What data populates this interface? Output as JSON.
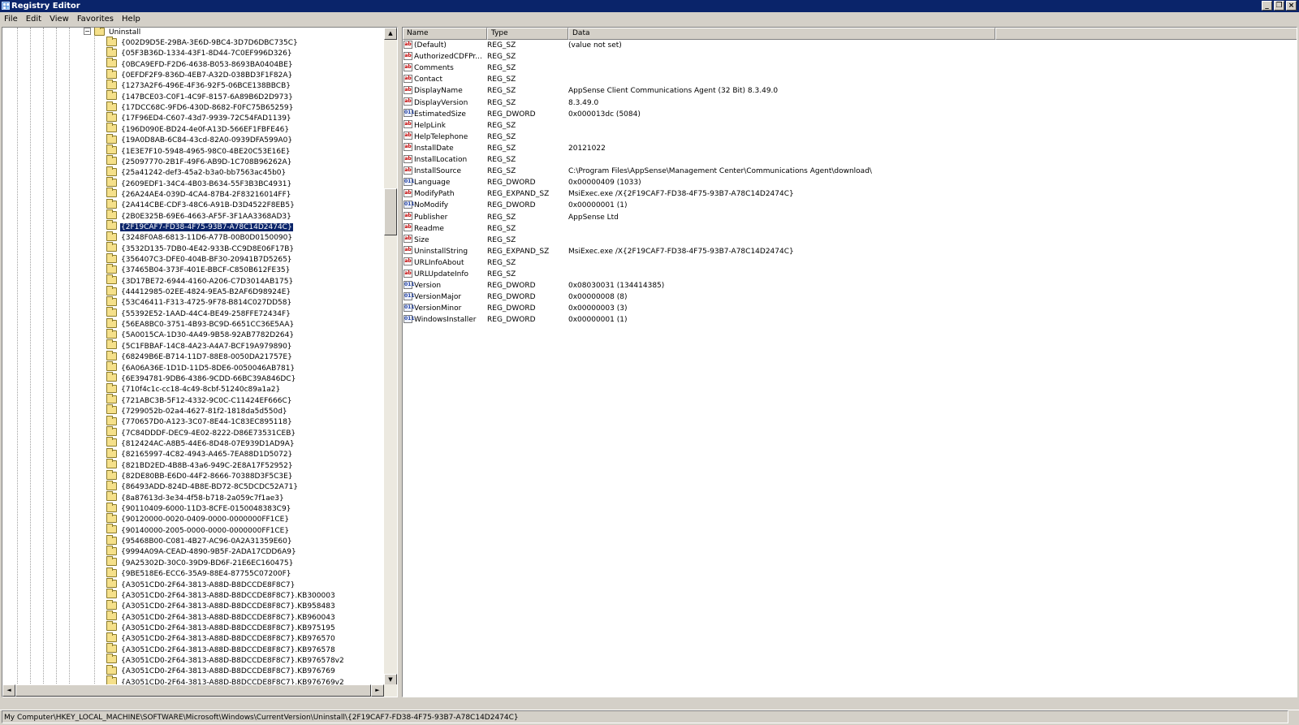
{
  "window": {
    "title": "Registry Editor"
  },
  "menu": [
    "File",
    "Edit",
    "View",
    "Favorites",
    "Help"
  ],
  "tree": {
    "parent_label": "Uninstall",
    "expander": "−",
    "selected_index": 18,
    "items": [
      "{002D9D5E-29BA-3E6D-9BC4-3D7D6DBC735C}",
      "{05F3B36D-1334-43F1-8D44-7C0EF996D326}",
      "{0BCA9EFD-F2D6-4638-B053-8693BA0404BE}",
      "{0EFDF2F9-836D-4EB7-A32D-038BD3F1F82A}",
      "{1273A2F6-496E-4F36-92F5-06BCE138BBCB}",
      "{147BCE03-C0F1-4C9F-8157-6A89B6D2D973}",
      "{17DCC68C-9FD6-430D-8682-F0FC75B65259}",
      "{17F96ED4-C607-43d7-9939-72C54FAD1139}",
      "{196D090E-BD24-4e0f-A13D-566EF1FBFE46}",
      "{19A0D8AB-6C84-43cd-82A0-0939DFA599A0}",
      "{1E3E7F10-5948-4965-98C0-4BE20C53E16E}",
      "{25097770-2B1F-49F6-AB9D-1C708B96262A}",
      "{25a41242-def3-45a2-b3a0-bb7563ac45b0}",
      "{2609EDF1-34C4-4B03-B634-55F3B3BC4931}",
      "{26A24AE4-039D-4CA4-87B4-2F83216014FF}",
      "{2A414CBE-CDF3-48C6-A91B-D3D4522F8EB5}",
      "{2B0E325B-69E6-4663-AF5F-3F1AA3368AD3}",
      "{2F19CAF7-FD38-4F75-93B7-A78C14D2474C}",
      "{3248F0A8-6813-11D6-A77B-00B0D0150090}",
      "{3532D135-7DB0-4E42-933B-CC9D8E06F17B}",
      "{356407C3-DFE0-404B-BF30-20941B7D5265}",
      "{37465B04-373F-401E-BBCF-C850B612FE35}",
      "{3D17BE72-6944-4160-A206-C7D3014AB175}",
      "{44412985-02EE-4824-9EA5-B2AF6D98924E}",
      "{53C46411-F313-4725-9F78-B814C027DD58}",
      "{55392E52-1AAD-44C4-BE49-258FFE72434F}",
      "{56EA8BC0-3751-4B93-BC9D-6651CC36E5AA}",
      "{5A0015CA-1D30-4A49-9B58-92AB7782D264}",
      "{5C1FBBAF-14C8-4A23-A4A7-BCF19A979890}",
      "{68249B6E-B714-11D7-88E8-0050DA21757E}",
      "{6A06A36E-1D1D-11D5-8DE6-0050046AB781}",
      "{6E394781-9DB6-4386-9CDD-66BC39A846DC}",
      "{710f4c1c-cc18-4c49-8cbf-51240c89a1a2}",
      "{721ABC3B-5F12-4332-9C0C-C11424EF666C}",
      "{7299052b-02a4-4627-81f2-1818da5d550d}",
      "{770657D0-A123-3C07-8E44-1C83EC895118}",
      "{7C84DDDF-DEC9-4E02-8222-D86E73531CEB}",
      "{812424AC-A8B5-44E6-8D48-07E939D1AD9A}",
      "{82165997-4C82-4943-A465-7EA88D1D5072}",
      "{821BD2ED-4B8B-43a6-949C-2E8A17F52952}",
      "{82DE80BB-E6D0-44F2-8666-70388D3F5C3E}",
      "{86493ADD-824D-4B8E-BD72-8C5DCDC52A71}",
      "{8a87613d-3e34-4f58-b718-2a059c7f1ae3}",
      "{90110409-6000-11D3-8CFE-0150048383C9}",
      "{90120000-0020-0409-0000-0000000FF1CE}",
      "{90140000-2005-0000-0000-0000000FF1CE}",
      "{95468B00-C081-4B27-AC96-0A2A31359E60}",
      "{9994A09A-CEAD-4890-9B5F-2ADA17CDD6A9}",
      "{9A25302D-30C0-39D9-BD6F-21E6EC160475}",
      "{9BE518E6-ECC6-35A9-88E4-87755C07200F}",
      "{A3051CD0-2F64-3813-A88D-B8DCCDE8F8C7}",
      "{A3051CD0-2F64-3813-A88D-B8DCCDE8F8C7}.KB300003",
      "{A3051CD0-2F64-3813-A88D-B8DCCDE8F8C7}.KB958483",
      "{A3051CD0-2F64-3813-A88D-B8DCCDE8F8C7}.KB960043",
      "{A3051CD0-2F64-3813-A88D-B8DCCDE8F8C7}.KB975195",
      "{A3051CD0-2F64-3813-A88D-B8DCCDE8F8C7}.KB976570",
      "{A3051CD0-2F64-3813-A88D-B8DCCDE8F8C7}.KB976578",
      "{A3051CD0-2F64-3813-A88D-B8DCCDE8F8C7}.KB976578v2",
      "{A3051CD0-2F64-3813-A88D-B8DCCDE8F8C7}.KB976769",
      "{A3051CD0-2F64-3813-A88D-B8DCCDE8F8C7}.KB976769v2"
    ]
  },
  "list": {
    "columns": [
      "Name",
      "Type",
      "Data"
    ],
    "rows": [
      {
        "icon": "string-value-icon",
        "name": "(Default)",
        "type": "REG_SZ",
        "data": "(value not set)"
      },
      {
        "icon": "string-value-icon",
        "name": "AuthorizedCDFPr...",
        "type": "REG_SZ",
        "data": ""
      },
      {
        "icon": "string-value-icon",
        "name": "Comments",
        "type": "REG_SZ",
        "data": ""
      },
      {
        "icon": "string-value-icon",
        "name": "Contact",
        "type": "REG_SZ",
        "data": ""
      },
      {
        "icon": "string-value-icon",
        "name": "DisplayName",
        "type": "REG_SZ",
        "data": "AppSense Client Communications Agent (32 Bit) 8.3.49.0"
      },
      {
        "icon": "string-value-icon",
        "name": "DisplayVersion",
        "type": "REG_SZ",
        "data": "8.3.49.0"
      },
      {
        "icon": "dword-value-icon",
        "name": "EstimatedSize",
        "type": "REG_DWORD",
        "data": "0x000013dc (5084)"
      },
      {
        "icon": "string-value-icon",
        "name": "HelpLink",
        "type": "REG_SZ",
        "data": ""
      },
      {
        "icon": "string-value-icon",
        "name": "HelpTelephone",
        "type": "REG_SZ",
        "data": ""
      },
      {
        "icon": "string-value-icon",
        "name": "InstallDate",
        "type": "REG_SZ",
        "data": "20121022"
      },
      {
        "icon": "string-value-icon",
        "name": "InstallLocation",
        "type": "REG_SZ",
        "data": ""
      },
      {
        "icon": "string-value-icon",
        "name": "InstallSource",
        "type": "REG_SZ",
        "data": "C:\\Program Files\\AppSense\\Management Center\\Communications Agent\\download\\"
      },
      {
        "icon": "dword-value-icon",
        "name": "Language",
        "type": "REG_DWORD",
        "data": "0x00000409 (1033)"
      },
      {
        "icon": "string-value-icon",
        "name": "ModifyPath",
        "type": "REG_EXPAND_SZ",
        "data": "MsiExec.exe /X{2F19CAF7-FD38-4F75-93B7-A78C14D2474C}"
      },
      {
        "icon": "dword-value-icon",
        "name": "NoModify",
        "type": "REG_DWORD",
        "data": "0x00000001 (1)"
      },
      {
        "icon": "string-value-icon",
        "name": "Publisher",
        "type": "REG_SZ",
        "data": "AppSense Ltd"
      },
      {
        "icon": "string-value-icon",
        "name": "Readme",
        "type": "REG_SZ",
        "data": ""
      },
      {
        "icon": "string-value-icon",
        "name": "Size",
        "type": "REG_SZ",
        "data": ""
      },
      {
        "icon": "string-value-icon",
        "name": "UninstallString",
        "type": "REG_EXPAND_SZ",
        "data": "MsiExec.exe /X{2F19CAF7-FD38-4F75-93B7-A78C14D2474C}"
      },
      {
        "icon": "string-value-icon",
        "name": "URLInfoAbout",
        "type": "REG_SZ",
        "data": ""
      },
      {
        "icon": "string-value-icon",
        "name": "URLUpdateInfo",
        "type": "REG_SZ",
        "data": ""
      },
      {
        "icon": "dword-value-icon",
        "name": "Version",
        "type": "REG_DWORD",
        "data": "0x08030031 (134414385)"
      },
      {
        "icon": "dword-value-icon",
        "name": "VersionMajor",
        "type": "REG_DWORD",
        "data": "0x00000008 (8)"
      },
      {
        "icon": "dword-value-icon",
        "name": "VersionMinor",
        "type": "REG_DWORD",
        "data": "0x00000003 (3)"
      },
      {
        "icon": "dword-value-icon",
        "name": "WindowsInstaller",
        "type": "REG_DWORD",
        "data": "0x00000001 (1)"
      }
    ]
  },
  "statusbar": {
    "path": "My Computer\\HKEY_LOCAL_MACHINE\\SOFTWARE\\Microsoft\\Windows\\CurrentVersion\\Uninstall\\{2F19CAF7-FD38-4F75-93B7-A78C14D2474C}"
  },
  "colors": {
    "titlebar": "#0a246a",
    "selection": "#0a246a",
    "chrome": "#d4d0c8"
  }
}
